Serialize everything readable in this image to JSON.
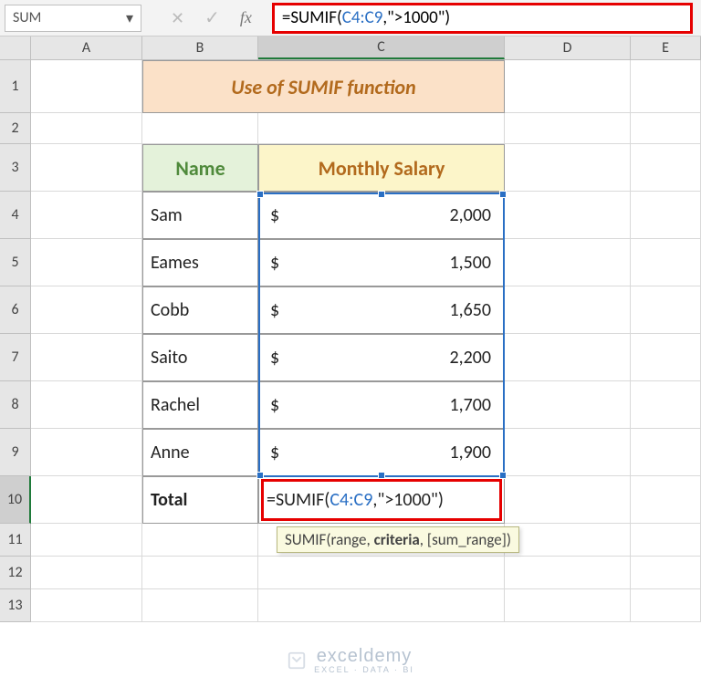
{
  "namebox": {
    "value": "SUM"
  },
  "formulabar": {
    "prefix": "=SUMIF(",
    "ref": "C4:C9",
    "suffix": ",\">1000\")"
  },
  "columns": [
    "A",
    "B",
    "C",
    "D",
    "E"
  ],
  "title": "Use of SUMIF function",
  "headers": {
    "name": "Name",
    "salary": "Monthly Salary"
  },
  "rows": [
    {
      "name": "Sam",
      "salary": "2,000"
    },
    {
      "name": "Eames",
      "salary": "1,500"
    },
    {
      "name": "Cobb",
      "salary": "1,650"
    },
    {
      "name": "Saito",
      "salary": "2,200"
    },
    {
      "name": "Rachel",
      "salary": "1,700"
    },
    {
      "name": "Anne",
      "salary": "1,900"
    }
  ],
  "currency": "$",
  "total_label": "Total",
  "total_formula": {
    "prefix": "=SUMIF(",
    "ref": "C4:C9",
    "suffix": ",\">1000\")"
  },
  "tooltip": {
    "fn": "SUMIF",
    "args_before": "(range, ",
    "arg_bold": "criteria",
    "args_after": ", [sum_range])"
  },
  "row_numbers": [
    "1",
    "2",
    "3",
    "4",
    "5",
    "6",
    "7",
    "8",
    "9",
    "10",
    "11",
    "12",
    "13"
  ],
  "watermark": {
    "brand": "exceldemy",
    "tagline": "EXCEL · DATA · BI"
  }
}
